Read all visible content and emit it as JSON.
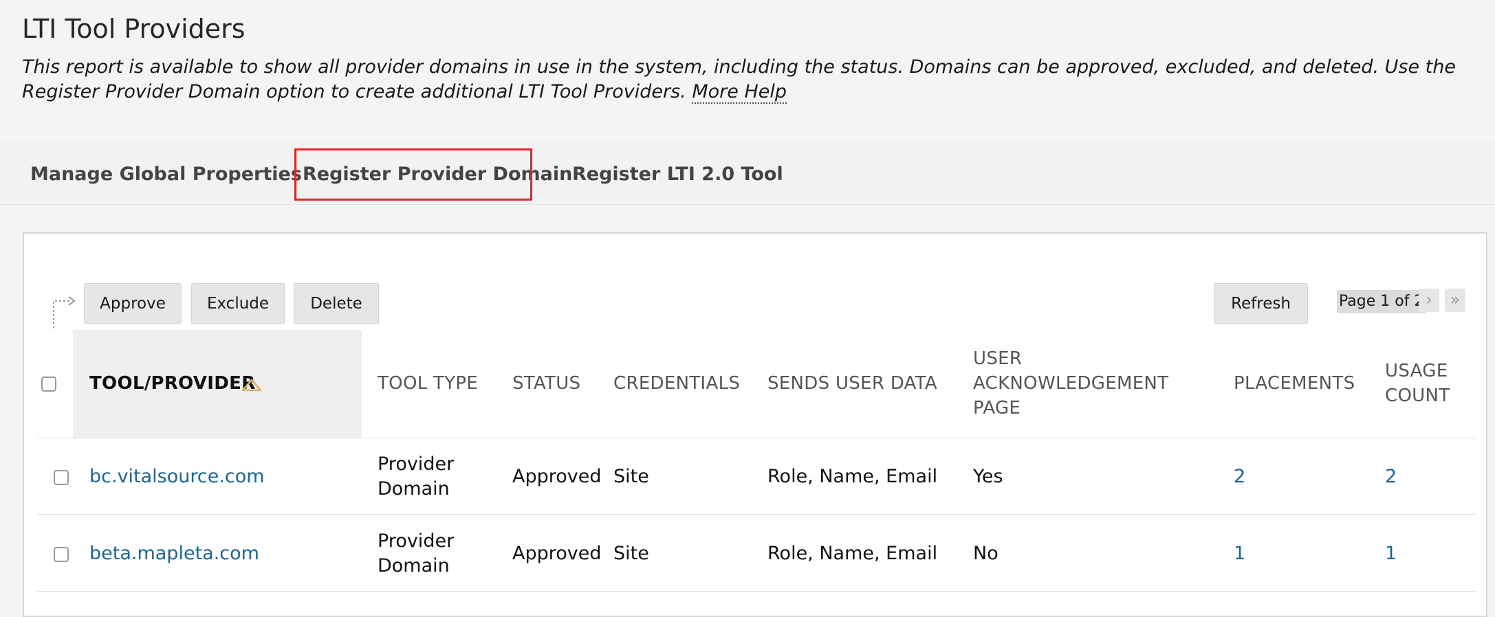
{
  "page": {
    "title": "LTI Tool Providers",
    "description_text": "This report is available to show all provider domains in use in the system, including the status. Domains can be approved, excluded, and deleted. Use the Register Provider Domain option to create additional LTI Tool Providers.",
    "more_help_label": "More Help"
  },
  "action_bar": {
    "items": [
      {
        "label": "Manage Global Properties"
      },
      {
        "label": "Register Provider Domain",
        "highlighted": true
      },
      {
        "label": "Register LTI 2.0 Tool"
      }
    ],
    "highlight_color": "#e8232a"
  },
  "toolbar": {
    "approve_label": "Approve",
    "exclude_label": "Exclude",
    "delete_label": "Delete",
    "refresh_label": "Refresh"
  },
  "pagination": {
    "label": "Page 1 of 2",
    "next_icon": "chevron-right-icon",
    "last_icon": "double-chevron-right-icon"
  },
  "table": {
    "columns": [
      {
        "label": "TOOL/PROVIDER",
        "sorted": "ascending"
      },
      {
        "label": "TOOL TYPE"
      },
      {
        "label": "STATUS"
      },
      {
        "label": "CREDENTIALS"
      },
      {
        "label": "SENDS USER DATA"
      },
      {
        "label_line1": "USER",
        "label_line2": "ACKNOWLEDGEMENT",
        "label_line3": "PAGE"
      },
      {
        "label": "PLACEMENTS"
      },
      {
        "label_line1": "USAGE",
        "label_line2": "COUNT"
      }
    ],
    "rows": [
      {
        "provider": "bc.vitalsource.com",
        "tool_type_line1": "Provider",
        "tool_type_line2": "Domain",
        "status": "Approved",
        "credentials": "Site",
        "sends_user_data": "Role, Name, Email",
        "ack_page": "Yes",
        "placements": "2",
        "usage_count": "2"
      },
      {
        "provider": "beta.mapleta.com",
        "tool_type_line1": "Provider",
        "tool_type_line2": "Domain",
        "status": "Approved",
        "credentials": "Site",
        "sends_user_data": "Role, Name, Email",
        "ack_page": "No",
        "placements": "1",
        "usage_count": "1"
      }
    ]
  },
  "colors": {
    "link": "#19669b",
    "background": "#f4f4f4"
  }
}
